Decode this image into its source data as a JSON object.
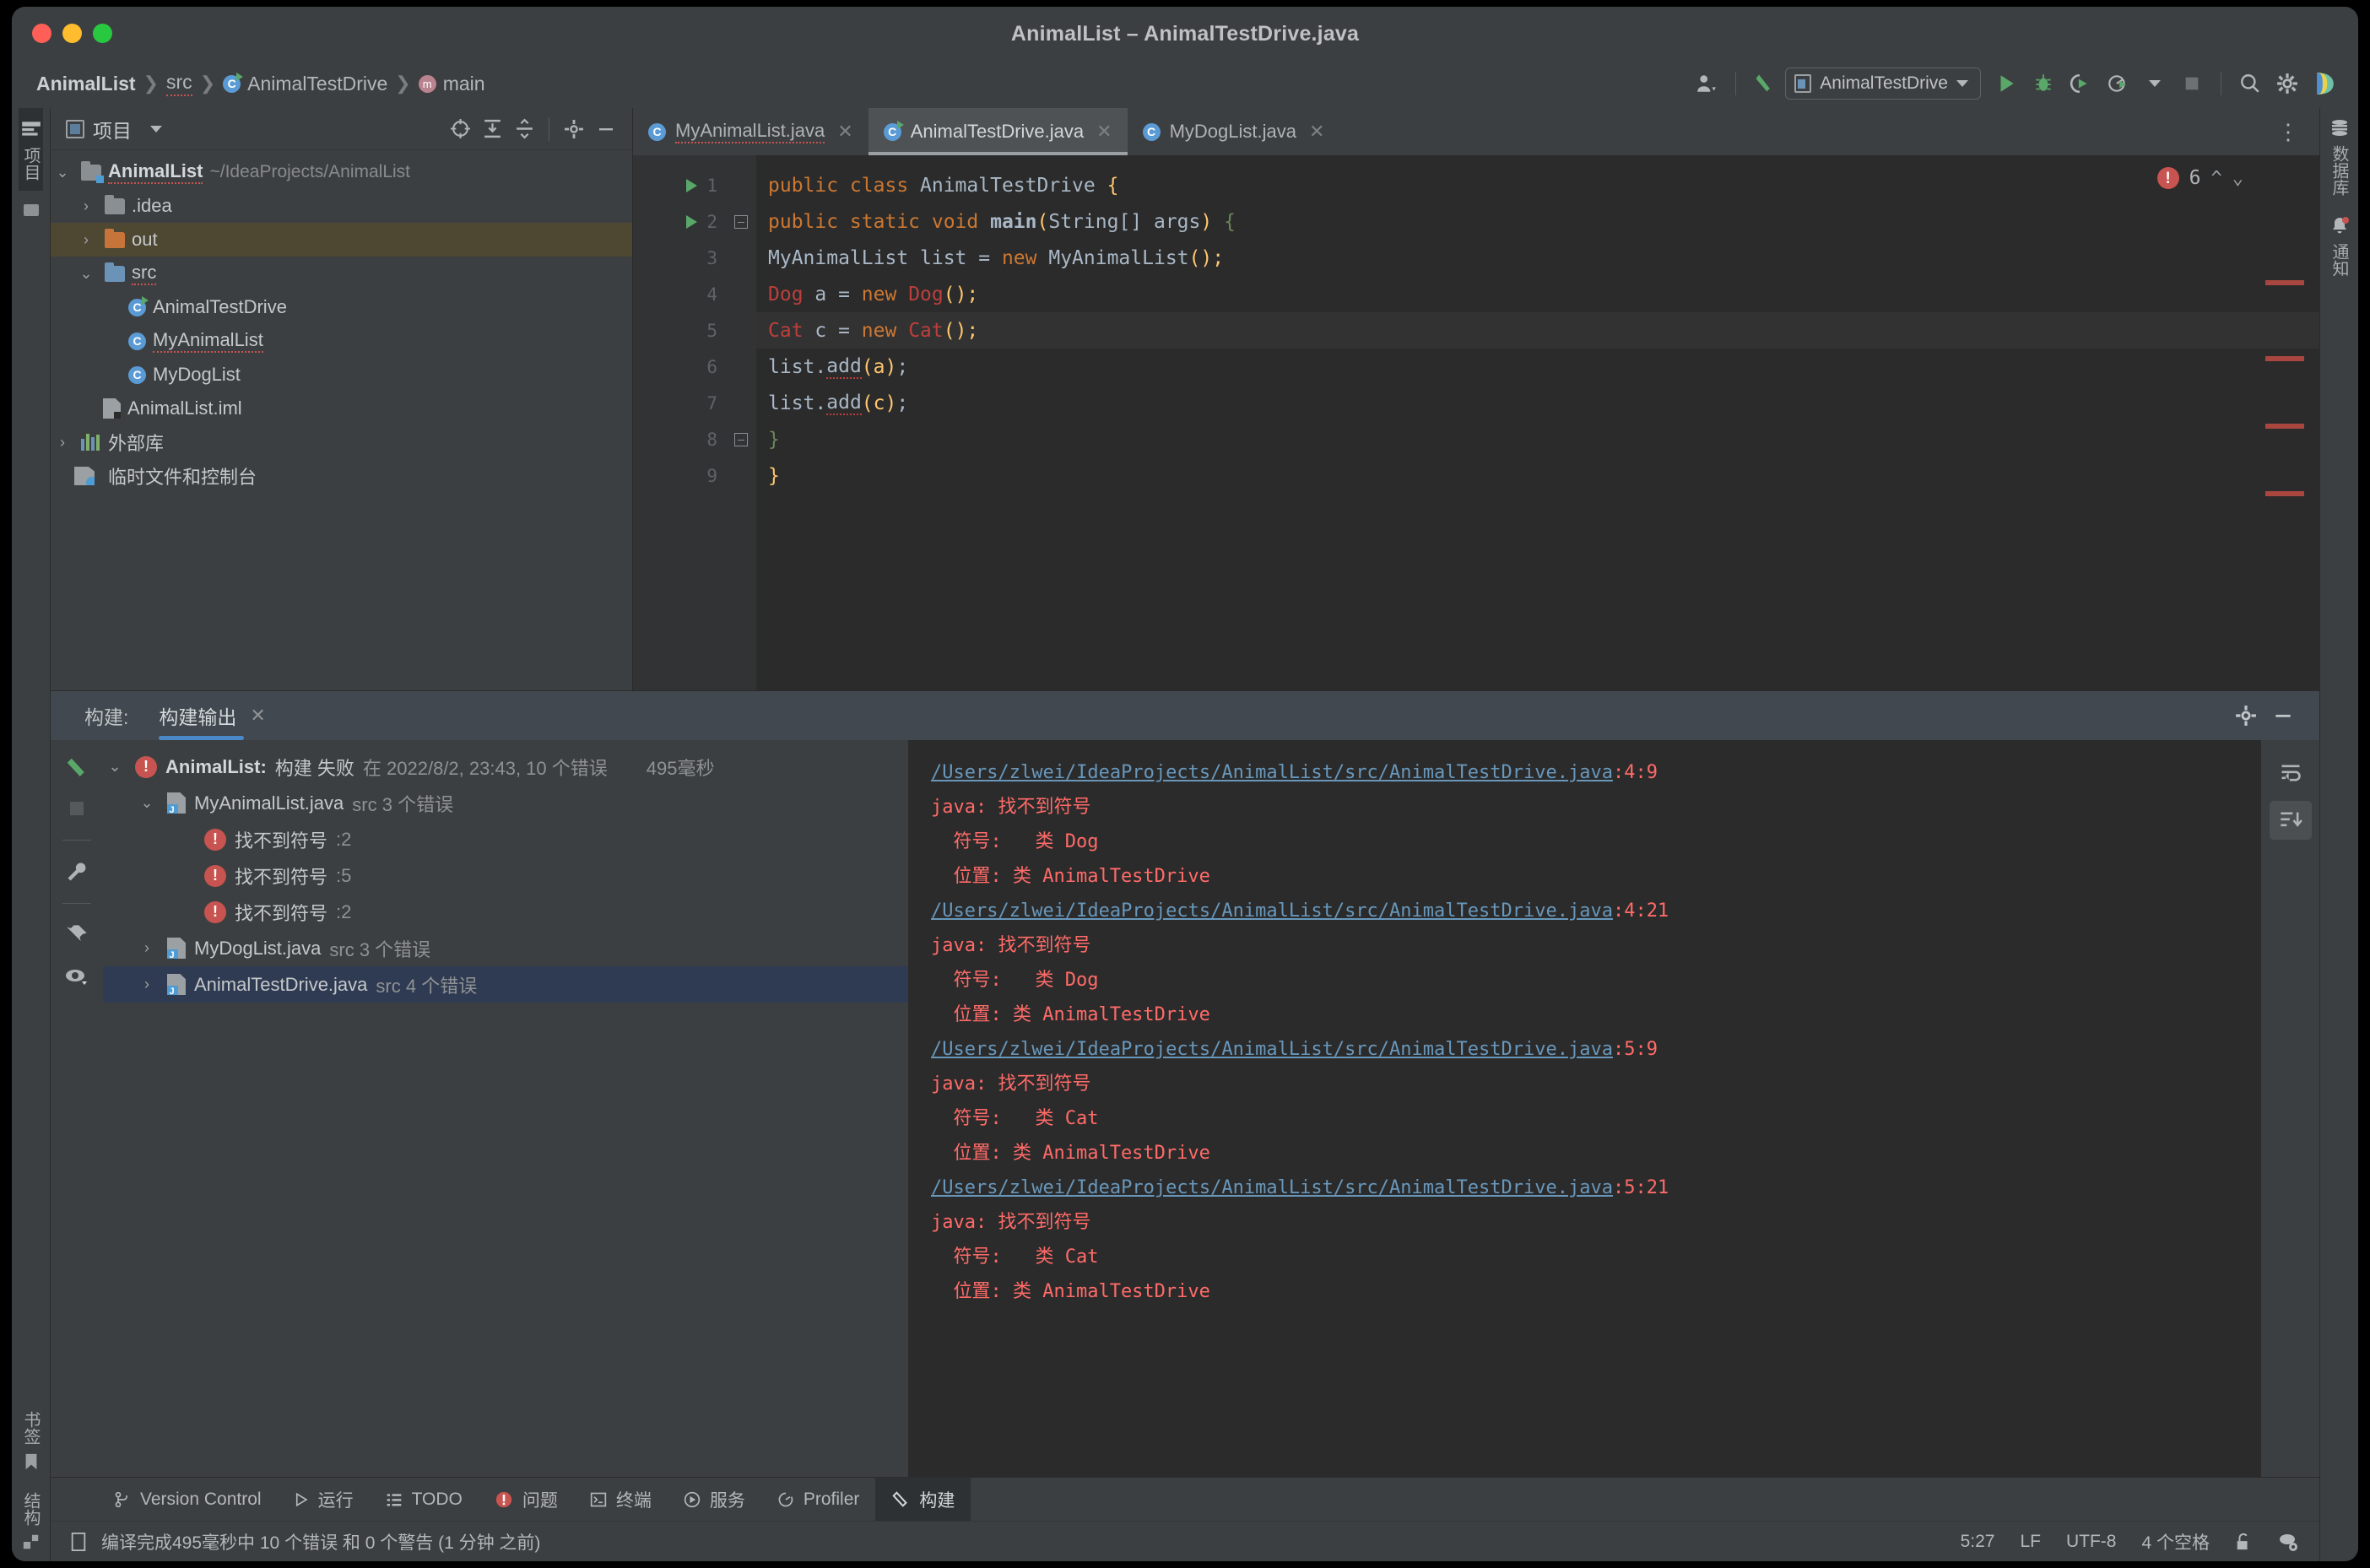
{
  "window": {
    "title": "AnimalList – AnimalTestDrive.java",
    "traffic": [
      "close",
      "minimize",
      "maximize"
    ]
  },
  "breadcrumbs": [
    {
      "label": "AnimalList",
      "icon": "none",
      "bold": true
    },
    {
      "label": "src",
      "icon": "none",
      "bold": false
    },
    {
      "label": "AnimalTestDrive",
      "icon": "class-icon",
      "bold": false
    },
    {
      "label": "main",
      "icon": "method-icon",
      "bold": false
    }
  ],
  "toolbar": {
    "user_icon": "user-account-icon",
    "build_icon": "build-hammer-icon",
    "run_config": "AnimalTestDrive",
    "run_icon": "run-icon",
    "debug_icon": "debug-icon",
    "coverage_icon": "run-with-coverage-icon",
    "profile_icon": "profiler-icon",
    "stop_icon": "stop-icon",
    "search_icon": "search-everywhere-icon",
    "settings_icon": "settings-gear-icon",
    "assistant_icon": "ai-assistant-icon"
  },
  "left_rail": [
    {
      "label": "项目",
      "icon": "project-icon",
      "active": true
    },
    {
      "label": "",
      "icon": "commit-icon",
      "active": false
    },
    {
      "label": "书签",
      "icon": "bookmark-icon",
      "active": false
    },
    {
      "label": "结构",
      "icon": "structure-icon",
      "active": false
    }
  ],
  "right_rail": [
    {
      "label": "数据库",
      "icon": "database-icon"
    },
    {
      "label": "通知",
      "icon": "notifications-bell-icon"
    }
  ],
  "project_panel": {
    "title": "项目",
    "tools": [
      "select-opened-file-icon",
      "expand-all-icon",
      "collapse-all-icon",
      "settings-gear-icon",
      "hide-icon"
    ],
    "tree": [
      {
        "label": "AnimalList",
        "suffix": "~/IdeaProjects/AnimalList",
        "icon": "module-folder-icon",
        "twist": "open",
        "indent": 0,
        "bold": true,
        "selected": false,
        "squiggle": true
      },
      {
        "label": ".idea",
        "suffix": "",
        "icon": "folder-icon",
        "twist": "closed",
        "indent": 1,
        "bold": false,
        "selected": false,
        "squiggle": false
      },
      {
        "label": "out",
        "suffix": "",
        "icon": "folder-orange-icon",
        "twist": "closed",
        "indent": 1,
        "bold": false,
        "selected": true,
        "squiggle": false
      },
      {
        "label": "src",
        "suffix": "",
        "icon": "folder-source-icon",
        "twist": "open",
        "indent": 1,
        "bold": false,
        "selected": false,
        "squiggle": true
      },
      {
        "label": "AnimalTestDrive",
        "suffix": "",
        "icon": "class-runnable-icon",
        "twist": "none",
        "indent": 2,
        "bold": false,
        "selected": false,
        "squiggle": false
      },
      {
        "label": "MyAnimalList",
        "suffix": "",
        "icon": "class-icon",
        "twist": "none",
        "indent": 2,
        "bold": false,
        "selected": false,
        "squiggle": true
      },
      {
        "label": "MyDogList",
        "suffix": "",
        "icon": "class-icon",
        "twist": "none",
        "indent": 2,
        "bold": false,
        "selected": false,
        "squiggle": false
      },
      {
        "label": "AnimalList.iml",
        "suffix": "",
        "icon": "iml-file-icon",
        "twist": "none",
        "indent": 1,
        "bold": false,
        "selected": false,
        "squiggle": false
      },
      {
        "label": "外部库",
        "suffix": "",
        "icon": "external-libraries-icon",
        "twist": "closed",
        "indent": 0,
        "bold": false,
        "selected": false,
        "squiggle": false
      },
      {
        "label": "临时文件和控制台",
        "suffix": "",
        "icon": "scratches-consoles-icon",
        "twist": "none",
        "indent": 0,
        "bold": false,
        "selected": false,
        "squiggle": false
      }
    ]
  },
  "editor": {
    "tabs": [
      {
        "label": "MyAnimalList.java",
        "icon": "class-icon",
        "active": false,
        "squiggle": true
      },
      {
        "label": "AnimalTestDrive.java",
        "icon": "class-runnable-icon",
        "active": true,
        "squiggle": false
      },
      {
        "label": "MyDogList.java",
        "icon": "class-icon",
        "active": false,
        "squiggle": false
      }
    ],
    "error_count": "6",
    "up_chevron": "prev-problem-icon",
    "down_chevron": "next-problem-icon",
    "lines": [
      {
        "n": "1",
        "runnable": true,
        "fold": false,
        "highlight": false
      },
      {
        "n": "2",
        "runnable": true,
        "fold": true,
        "highlight": false
      },
      {
        "n": "3",
        "runnable": false,
        "fold": false,
        "highlight": false
      },
      {
        "n": "4",
        "runnable": false,
        "fold": false,
        "highlight": false
      },
      {
        "n": "5",
        "runnable": false,
        "fold": false,
        "highlight": true
      },
      {
        "n": "6",
        "runnable": false,
        "fold": false,
        "highlight": false
      },
      {
        "n": "7",
        "runnable": false,
        "fold": false,
        "highlight": false
      },
      {
        "n": "8",
        "runnable": false,
        "fold": true,
        "highlight": false
      },
      {
        "n": "9",
        "runnable": false,
        "fold": false,
        "highlight": false
      }
    ],
    "code_text": [
      "public class AnimalTestDrive {",
      "    public static void main(String[] args) {",
      "        MyAnimalList list = new MyAnimalList();",
      "        Dog a = new Dog();",
      "        Cat c = new Cat();",
      "        list.add(a);",
      "        list.add(c);",
      "    }",
      "}"
    ]
  },
  "build_panel": {
    "label": "构建:",
    "tab": "构建输出",
    "close_icon": "close-icon",
    "header_tools": [
      "settings-gear-icon",
      "hide-icon"
    ],
    "rail": [
      "rebuild-hammer-icon",
      "stop-icon",
      "settings-wrench-icon",
      "pin-icon",
      "eye-icon"
    ],
    "console_tools": [
      "soft-wrap-icon",
      "scroll-to-end-icon"
    ],
    "tree": [
      {
        "label": "AnimalList: 构建 失败 在 2022/8/2, 23:43,  10 个错误",
        "bold_part": "AnimalList:",
        "duration": "495毫秒",
        "icon": "error-icon",
        "twist": "open",
        "indent": 0,
        "selected": false
      },
      {
        "label": "MyAnimalList.java",
        "suffix": "src 3 个错误",
        "duration": "",
        "icon": "java-file-icon",
        "twist": "open",
        "indent": 1,
        "selected": false
      },
      {
        "label": "找不到符号",
        "suffix": ":2",
        "duration": "",
        "icon": "error-icon",
        "twist": "none",
        "indent": 2,
        "selected": false
      },
      {
        "label": "找不到符号",
        "suffix": ":5",
        "duration": "",
        "icon": "error-icon",
        "twist": "none",
        "indent": 2,
        "selected": false
      },
      {
        "label": "找不到符号",
        "suffix": ":2",
        "duration": "",
        "icon": "error-icon",
        "twist": "none",
        "indent": 2,
        "selected": false
      },
      {
        "label": "MyDogList.java",
        "suffix": "src 3 个错误",
        "duration": "",
        "icon": "java-file-icon",
        "twist": "closed",
        "indent": 1,
        "selected": false
      },
      {
        "label": "AnimalTestDrive.java",
        "suffix": "src 4 个错误",
        "duration": "",
        "icon": "java-file-icon",
        "twist": "closed",
        "indent": 1,
        "selected": true
      }
    ],
    "console": [
      {
        "type": "link",
        "path": "/Users/zlwei/IdeaProjects/AnimalList/src/AnimalTestDrive.java",
        "pos": ":4:9"
      },
      {
        "type": "text",
        "text": "java: 找不到符号"
      },
      {
        "type": "text",
        "text": "  符号:   类 Dog"
      },
      {
        "type": "text",
        "text": "  位置: 类 AnimalTestDrive"
      },
      {
        "type": "link",
        "path": "/Users/zlwei/IdeaProjects/AnimalList/src/AnimalTestDrive.java",
        "pos": ":4:21"
      },
      {
        "type": "text",
        "text": "java: 找不到符号"
      },
      {
        "type": "text",
        "text": "  符号:   类 Dog"
      },
      {
        "type": "text",
        "text": "  位置: 类 AnimalTestDrive"
      },
      {
        "type": "link",
        "path": "/Users/zlwei/IdeaProjects/AnimalList/src/AnimalTestDrive.java",
        "pos": ":5:9"
      },
      {
        "type": "text",
        "text": "java: 找不到符号"
      },
      {
        "type": "text",
        "text": "  符号:   类 Cat"
      },
      {
        "type": "text",
        "text": "  位置: 类 AnimalTestDrive"
      },
      {
        "type": "link",
        "path": "/Users/zlwei/IdeaProjects/AnimalList/src/AnimalTestDrive.java",
        "pos": ":5:21"
      },
      {
        "type": "text",
        "text": "java: 找不到符号"
      },
      {
        "type": "text",
        "text": "  符号:   类 Cat"
      },
      {
        "type": "text",
        "text": "  位置: 类 AnimalTestDrive"
      }
    ]
  },
  "toolwindow_bar": [
    {
      "label": "Version Control",
      "icon": "version-control-icon",
      "active": false
    },
    {
      "label": "运行",
      "icon": "run-icon",
      "active": false
    },
    {
      "label": "TODO",
      "icon": "todo-list-icon",
      "active": false
    },
    {
      "label": "问题",
      "icon": "problems-error-icon",
      "active": false
    },
    {
      "label": "终端",
      "icon": "terminal-icon",
      "active": false
    },
    {
      "label": "服务",
      "icon": "services-icon",
      "active": false
    },
    {
      "label": "Profiler",
      "icon": "profiler-icon",
      "active": false
    },
    {
      "label": "构建",
      "icon": "build-hammer-icon",
      "active": true
    }
  ],
  "statusbar": {
    "icon": "memory-indicator-icon",
    "message": "编译完成495毫秒中 10 个错误 和 0 个警告 (1 分钟 之前)",
    "caret": "5:27",
    "line_sep": "LF",
    "encoding": "UTF-8",
    "indent": "4 个空格",
    "lock_icon": "read-only-lock-icon",
    "events_icon": "event-log-icon"
  },
  "colors": {
    "accent_blue": "#4a88c7",
    "error_red": "#c75450",
    "run_green": "#59a869",
    "link_blue": "#6897bb",
    "console_red": "#ff6b68",
    "selection_amber": "#4e4833"
  }
}
